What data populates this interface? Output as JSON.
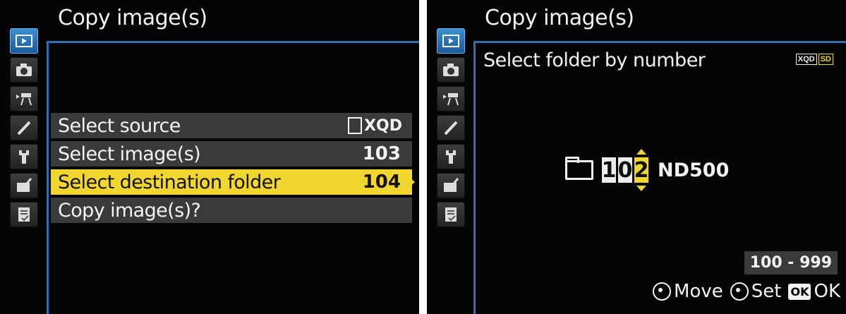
{
  "left": {
    "title": "Copy image(s)",
    "menu": [
      {
        "label": "Select source",
        "value": "XQD"
      },
      {
        "label": "Select image(s)",
        "value": "103"
      },
      {
        "label": "Select destination folder",
        "value": "104"
      },
      {
        "label": "Copy image(s)?",
        "value": ""
      }
    ],
    "tabs": [
      "playback-icon",
      "camera-icon",
      "movie-icon",
      "pencil-icon",
      "wrench-icon",
      "retouch-icon",
      "my-menu-icon"
    ],
    "selected_index": 2
  },
  "right": {
    "title": "Copy image(s)",
    "subtitle": "Select folder by number",
    "sd_badge": [
      "XQD",
      "SD"
    ],
    "folder": {
      "digits": [
        "1",
        "0",
        "2"
      ],
      "active_digit": 2,
      "name": "ND500"
    },
    "range": "100 - 999",
    "hints": {
      "move": "Move",
      "set": "Set",
      "ok_badge": "OK",
      "ok": "OK"
    }
  },
  "colors": {
    "highlight": "#f2d630",
    "accent_blue": "#2f6fb4",
    "row_bg": "#3a3a3a",
    "background": "#050505"
  }
}
